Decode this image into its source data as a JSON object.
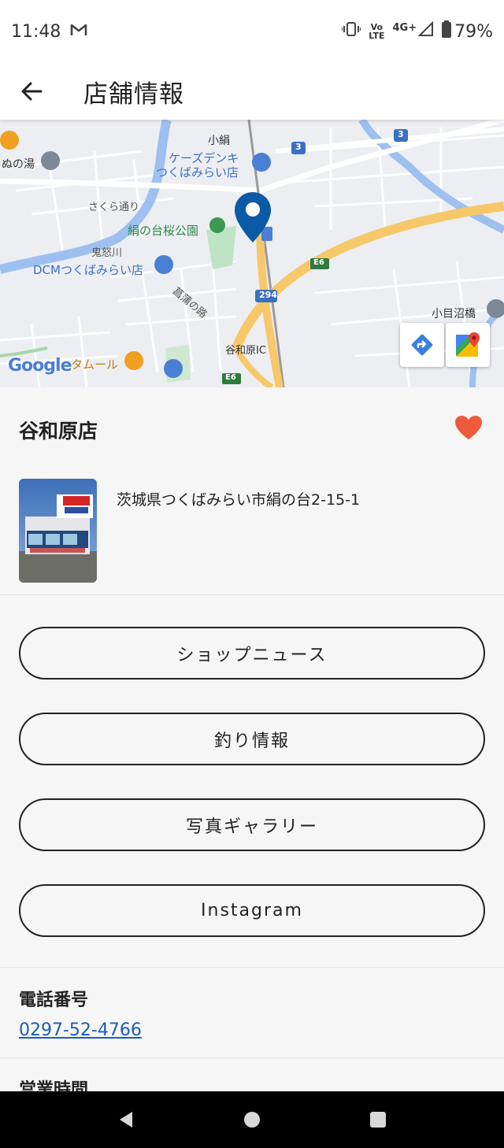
{
  "status_bar": {
    "time": "11:48",
    "mail_icon": "gmail-icon",
    "volte_line1": "Vo",
    "volte_line2": "LTE",
    "network": "4G+",
    "battery": "79%"
  },
  "app_bar": {
    "back_icon": "arrow-left-icon",
    "title": "店舗情報"
  },
  "map": {
    "labels": {
      "kozu": "小絹",
      "ksdenki": "ケーズデンキ",
      "ksdenki2": "つくばみらい店",
      "nunoyu": "ぬの湯",
      "sakura": "さくら通り",
      "park": "絹の台桜公園",
      "kinu": "鬼怒川",
      "dcm": "DCMつくばみらい店",
      "ayame": "菖蒲の路",
      "yawarahara_ic": "谷和原IC",
      "kome": "小目沼橋",
      "tamuru": "タムール",
      "route294": "294",
      "e6a": "E6",
      "e6b": "E6",
      "route3a": "3",
      "route3b": "3"
    },
    "google_logo": "Google",
    "directions_icon": "directions-icon",
    "google_maps_icon": "google-maps-icon",
    "pin_color": "#0b5aa6"
  },
  "store": {
    "name": "谷和原店",
    "favorite_icon": "heart-icon",
    "favorite_color": "#f05a3c",
    "address": "茨城県つくばみらい市絹の台2-15-1"
  },
  "buttons": {
    "shop_news": "ショップニュース",
    "fishing_info": "釣り情報",
    "photo_gallery": "写真ギャラリー",
    "instagram": "Instagram"
  },
  "phone": {
    "label": "電話番号",
    "number": "0297-52-4766"
  },
  "hours": {
    "label": "営業時間"
  },
  "nav_bar": {
    "back": "back-triangle-icon",
    "home": "home-circle-icon",
    "recents": "recents-square-icon"
  }
}
